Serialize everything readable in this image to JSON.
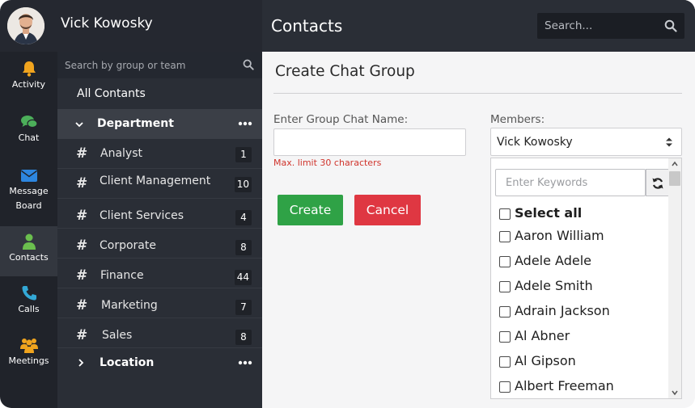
{
  "user": {
    "name": "Vick Kowosky"
  },
  "header": {
    "title": "Contacts",
    "search_placeholder": "Search..."
  },
  "rail": [
    {
      "label": "Activity",
      "icon": "bell-icon",
      "color": "#f0a41e"
    },
    {
      "label": "Chat",
      "icon": "chat-icon",
      "color": "#4caf5a"
    },
    {
      "label": "Message",
      "label2": "Board",
      "icon": "envelope-icon",
      "color": "#2d86e0"
    },
    {
      "label": "Contacts",
      "icon": "person-icon",
      "color": "#6bbf4e",
      "active": true
    },
    {
      "label": "Calls",
      "icon": "phone-icon",
      "color": "#33a8d6"
    },
    {
      "label": "Meetings",
      "icon": "group-icon",
      "color": "#f0a41e"
    }
  ],
  "groups": {
    "search_placeholder": "Search by group or team",
    "all_label": "All Contants",
    "department": "Department",
    "location": "Location",
    "teams": [
      {
        "name": "Analyst",
        "count": "1"
      },
      {
        "name": "Client Management",
        "count": "10"
      },
      {
        "name": "Client Services",
        "count": "4"
      },
      {
        "name": "Corporate",
        "count": "8"
      },
      {
        "name": "Finance",
        "count": "44"
      },
      {
        "name": "Marketing",
        "count": "7"
      },
      {
        "name": "Sales",
        "count": "8"
      }
    ]
  },
  "form": {
    "title": "Create Chat Group",
    "name_label": "Enter Group Chat Name:",
    "name_value": "",
    "hint": "Max. limit 30 characters",
    "create_label": "Create",
    "cancel_label": "Cancel",
    "members_label": "Members:",
    "members_selected": "Vick Kowosky",
    "keywords_placeholder": "Enter Keywords",
    "select_all": "Select all",
    "members": [
      "Aaron William",
      "Adele Adele",
      "Adele Smith",
      "Adrain Jackson",
      "Al Abner",
      "Al Gipson",
      "Albert Freeman"
    ]
  },
  "colors": {
    "create": "#2fa246",
    "cancel": "#df3742",
    "hint": "#d0342c"
  }
}
